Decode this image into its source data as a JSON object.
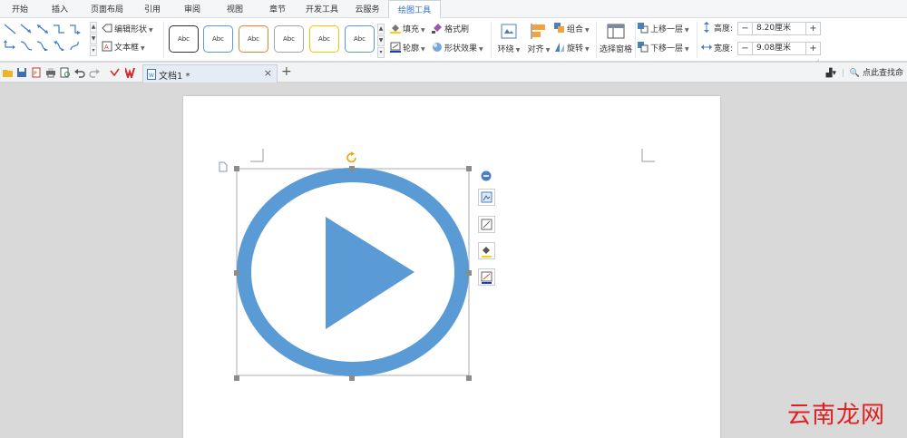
{
  "menu_tabs": [
    "开始",
    "插入",
    "页面布局",
    "引用",
    "审阅",
    "视图",
    "章节",
    "开发工具",
    "云服务",
    "绘图工具"
  ],
  "active_tab": "绘图工具",
  "ribbon": {
    "edit_shape": "编辑形状",
    "text_box": "文本框",
    "style_label": "Abc",
    "style_border_colors": [
      "#333333",
      "#5b9bd5",
      "#ed7d31",
      "#a5a5a5",
      "#ffc000",
      "#5b9bd5"
    ],
    "fill": "填充",
    "format_brush": "格式刷",
    "outline": "轮廓",
    "shape_effect": "形状效果",
    "wrap": "环绕",
    "align": "对齐",
    "group": "组合",
    "rotate": "旋转",
    "selection_pane": "选择窗格",
    "bring_forward": "上移一层",
    "send_backward": "下移一层",
    "height_label": "高度:",
    "height_value": "8.20厘米",
    "width_label": "宽度:",
    "width_value": "9.08厘米"
  },
  "document": {
    "tab_title": "文档1 *",
    "search_label": "点此查找命"
  },
  "shape": {
    "ring_color": "#5b9bd5"
  },
  "watermark": "云南龙网",
  "colors": {
    "accent": "#2d6fc7",
    "shape": "#5b9bd5"
  }
}
